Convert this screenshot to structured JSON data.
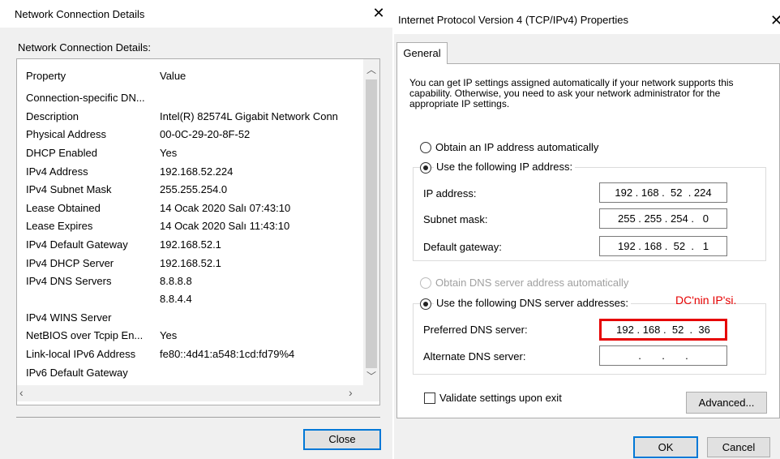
{
  "left": {
    "title": "Network Connection Details",
    "close_glyph": "✕",
    "group_label": "Network Connection Details:",
    "columns": [
      "Property",
      "Value"
    ],
    "rows": [
      {
        "property": "Connection-specific DN...",
        "value": ""
      },
      {
        "property": "Description",
        "value": "Intel(R) 82574L Gigabit Network Conn"
      },
      {
        "property": "Physical Address",
        "value": "00-0C-29-20-8F-52"
      },
      {
        "property": "DHCP Enabled",
        "value": "Yes"
      },
      {
        "property": "IPv4 Address",
        "value": "192.168.52.224"
      },
      {
        "property": "IPv4 Subnet Mask",
        "value": "255.255.254.0"
      },
      {
        "property": "Lease Obtained",
        "value": "14 Ocak 2020 Salı 07:43:10"
      },
      {
        "property": "Lease Expires",
        "value": "14 Ocak 2020 Salı 11:43:10"
      },
      {
        "property": "IPv4 Default Gateway",
        "value": "192.168.52.1"
      },
      {
        "property": "IPv4 DHCP Server",
        "value": "192.168.52.1"
      },
      {
        "property": "IPv4 DNS Servers",
        "value": "8.8.8.8"
      },
      {
        "property": "",
        "value": "8.8.4.4"
      },
      {
        "property": "IPv4 WINS Server",
        "value": ""
      },
      {
        "property": "NetBIOS over Tcpip En...",
        "value": "Yes"
      },
      {
        "property": "Link-local IPv6 Address",
        "value": "fe80::4d41:a548:1cd:fd79%4"
      },
      {
        "property": "IPv6 Default Gateway",
        "value": ""
      }
    ],
    "close_button": "Close"
  },
  "right": {
    "title": "Internet Protocol Version 4 (TCP/IPv4) Properties",
    "close_glyph": "✕",
    "tab": "General",
    "intro": "You can get IP settings assigned automatically if your network supports this capability. Otherwise, you need to ask your network administrator for the appropriate IP settings.",
    "radio_auto_ip": "Obtain an IP address automatically",
    "radio_static_ip": "Use the following IP address:",
    "ip_label": "IP address:",
    "ip_value": "192 . 168 .  52  . 224",
    "subnet_label": "Subnet mask:",
    "subnet_value": "255 . 255 . 254 .   0",
    "gateway_label": "Default gateway:",
    "gateway_value": "192 . 168 .  52  .   1",
    "radio_auto_dns": "Obtain DNS server address automatically",
    "radio_static_dns": "Use the following DNS server addresses:",
    "annotation": "DC'nin IP'si.",
    "preferred_label": "Preferred DNS server:",
    "preferred_value": "192 . 168 .  52  .  36",
    "alternate_label": "Alternate DNS server:",
    "alternate_value": "     .       .       .     ",
    "validate_label": "Validate settings upon exit",
    "advanced_button": "Advanced...",
    "ok_button": "OK",
    "cancel_button": "Cancel"
  }
}
